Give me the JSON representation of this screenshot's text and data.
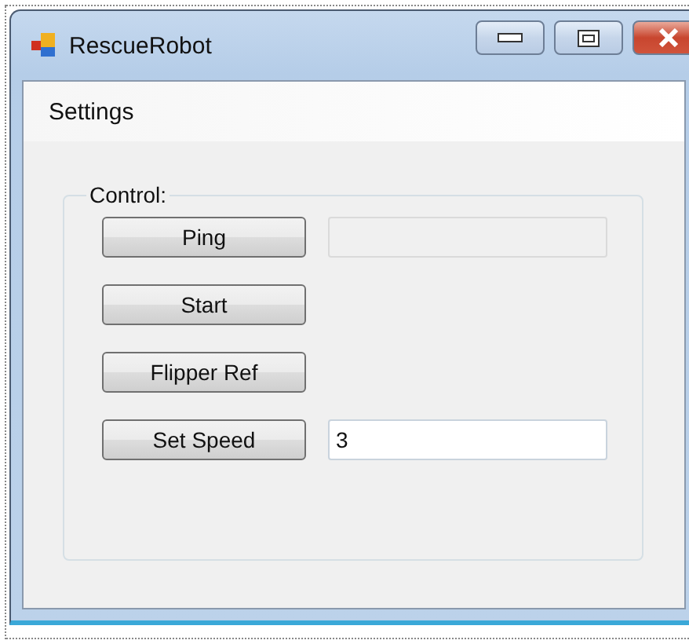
{
  "window": {
    "title": "RescueRobot"
  },
  "menu": [
    {
      "label": "Settings"
    }
  ],
  "group": {
    "title": "Control:",
    "rows": [
      {
        "button": "Ping",
        "field": {
          "kind": "text",
          "disabled": true
        }
      },
      {
        "button": "Start"
      },
      {
        "button": "Flipper Ref"
      },
      {
        "button": "Set Speed",
        "field": {
          "kind": "text",
          "value": "3",
          "disabled": false
        }
      }
    ]
  }
}
